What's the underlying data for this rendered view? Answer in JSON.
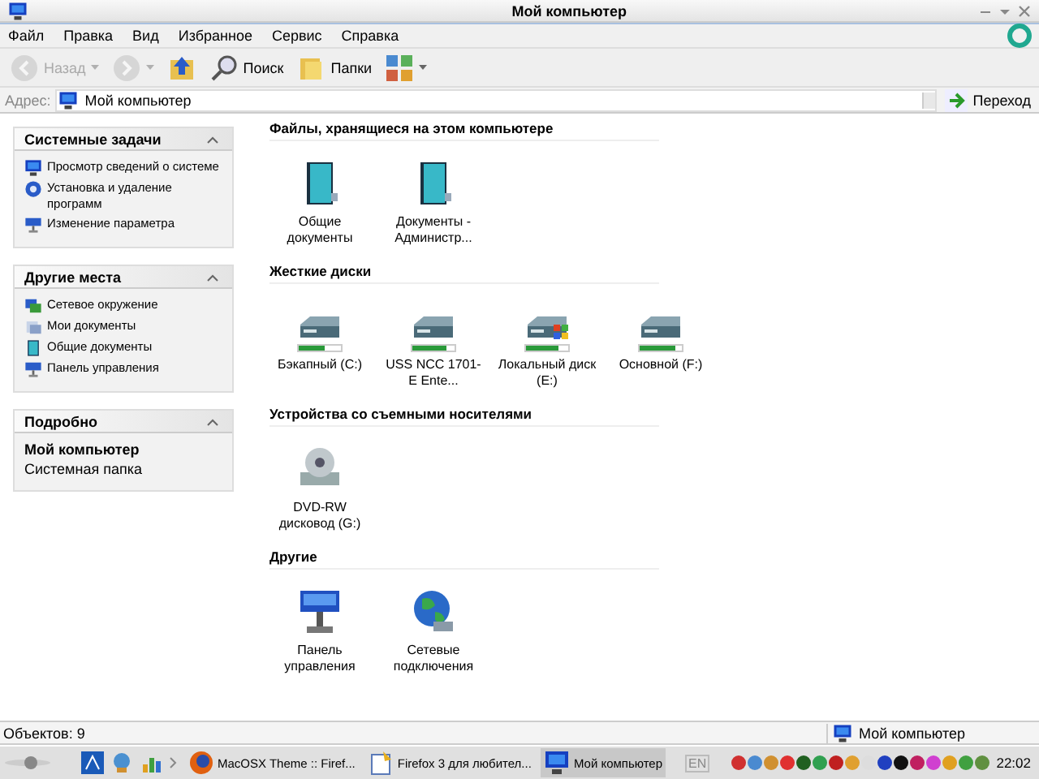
{
  "window": {
    "title": "Мой компьютер"
  },
  "menu": [
    {
      "label": "Файл"
    },
    {
      "label": "Правка"
    },
    {
      "label": "Вид"
    },
    {
      "label": "Избранное"
    },
    {
      "label": "Сервис"
    },
    {
      "label": "Справка"
    }
  ],
  "toolbar": [
    {
      "kind": "back",
      "label": "Назад",
      "disabled": true
    },
    {
      "kind": "forward",
      "disabled": true
    },
    {
      "kind": "up",
      "disabled": false
    },
    {
      "kind": "search",
      "label": "Поиск",
      "disabled": false
    },
    {
      "kind": "folders",
      "label": "Папки",
      "disabled": false
    },
    {
      "kind": "views",
      "disabled": false
    }
  ],
  "address": {
    "label": "Адрес:",
    "value": "Мой компьютер",
    "go": "Переход"
  },
  "sidebar": [
    {
      "title": "Системные задачи",
      "items": [
        {
          "kind": "monitor",
          "label": "Просмотр сведений о системе"
        },
        {
          "kind": "install",
          "label": "Установка и удаление программ"
        },
        {
          "kind": "panel",
          "label": "Изменение параметра"
        }
      ]
    },
    {
      "title": "Другие места",
      "items": [
        {
          "kind": "network",
          "label": "Сетевое окружение"
        },
        {
          "kind": "mydocs",
          "label": "Мои документы"
        },
        {
          "kind": "book",
          "label": "Общие документы"
        },
        {
          "kind": "panel",
          "label": "Панель управления"
        }
      ]
    },
    {
      "title": "Подробно",
      "details": {
        "name": "Мой компьютер",
        "type": "Системная папка"
      }
    }
  ],
  "groups": [
    {
      "title": "Файлы, хранящиеся на этом компьютере",
      "items": [
        {
          "kind": "book",
          "label": "Общие документы"
        },
        {
          "kind": "book",
          "label": "Документы - Администр..."
        }
      ]
    },
    {
      "title": "Жесткие диски",
      "items": [
        {
          "kind": "drive",
          "label": "Бэкапный (C:)",
          "level": 0.6
        },
        {
          "kind": "drive",
          "label": "USS NCC 1701-E Ente...",
          "level": 0.8
        },
        {
          "kind": "drive-win",
          "label": "Локальный диск (E:)",
          "level": 0.75
        },
        {
          "kind": "drive",
          "label": "Основной (F:)",
          "level": 0.85
        }
      ]
    },
    {
      "title": "Устройства со съемными носителями",
      "items": [
        {
          "kind": "dvd",
          "label": "DVD-RW дисковод (G:)"
        }
      ]
    },
    {
      "title": "Другие",
      "items": [
        {
          "kind": "panel",
          "label": "Панель управления"
        },
        {
          "kind": "globe",
          "label": "Сетевые подключения"
        }
      ]
    }
  ],
  "status_bar": {
    "objects": "Объектов: 9",
    "location": "Мой компьютер"
  },
  "taskbar": {
    "tasks": [
      {
        "kind": "firefox",
        "label": "MacOSX Theme :: Firef...",
        "selected": false
      },
      {
        "kind": "note",
        "label": "Firefox 3 для любител...",
        "selected": false
      },
      {
        "kind": "monitor",
        "label": "Мой компьютер",
        "selected": true
      }
    ],
    "language": "EN",
    "clock": "22:02"
  }
}
